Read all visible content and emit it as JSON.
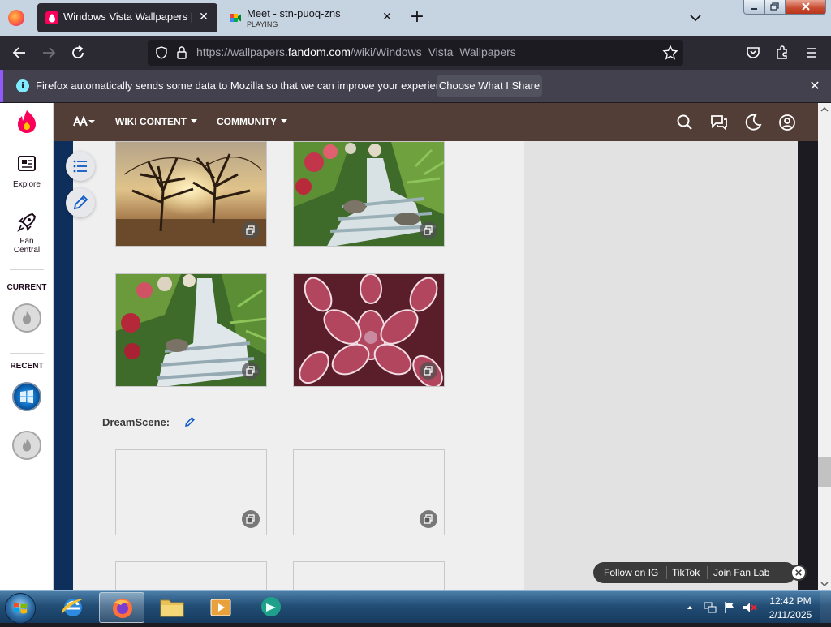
{
  "browser": {
    "tabs": [
      {
        "title": "Windows Vista Wallpapers | Wa",
        "active": true
      },
      {
        "title": "Meet - stn-puoq-zns",
        "subtitle": "PLAYING",
        "active": false
      }
    ],
    "new_tab_label": "+",
    "url_prefix": "https://wallpapers.",
    "url_domain": "fandom.com",
    "url_path": "/wiki/Windows_Vista_Wallpapers",
    "accent": "#9059ff"
  },
  "notification": {
    "icon": "i",
    "text": "Firefox automatically sends some data to Mozilla so that we can improve your experience.",
    "button": "Choose What I Share",
    "close": "✕"
  },
  "rail": {
    "explore_label": "Explore",
    "fan_central_label_1": "Fan",
    "fan_central_label_2": "Central",
    "current_heading": "CURRENT",
    "recent_heading": "RECENT"
  },
  "wiki_nav": {
    "wiki_content": "WIKI CONTENT",
    "community": "COMMUNITY",
    "bar_color": "#523e37"
  },
  "article": {
    "section_title": "DreamScene:",
    "gallery_top": [
      {
        "name": "trees-at-sunrise"
      },
      {
        "name": "stream-in-forest"
      },
      {
        "name": "waterfall-cascade"
      },
      {
        "name": "frosted-leaves"
      }
    ]
  },
  "follow_bar": {
    "ig": "Follow on IG",
    "tiktok": "TikTok",
    "fan_lab": "Join Fan Lab"
  },
  "taskbar": {
    "time": "12:42 PM",
    "date": "2/11/2025"
  }
}
